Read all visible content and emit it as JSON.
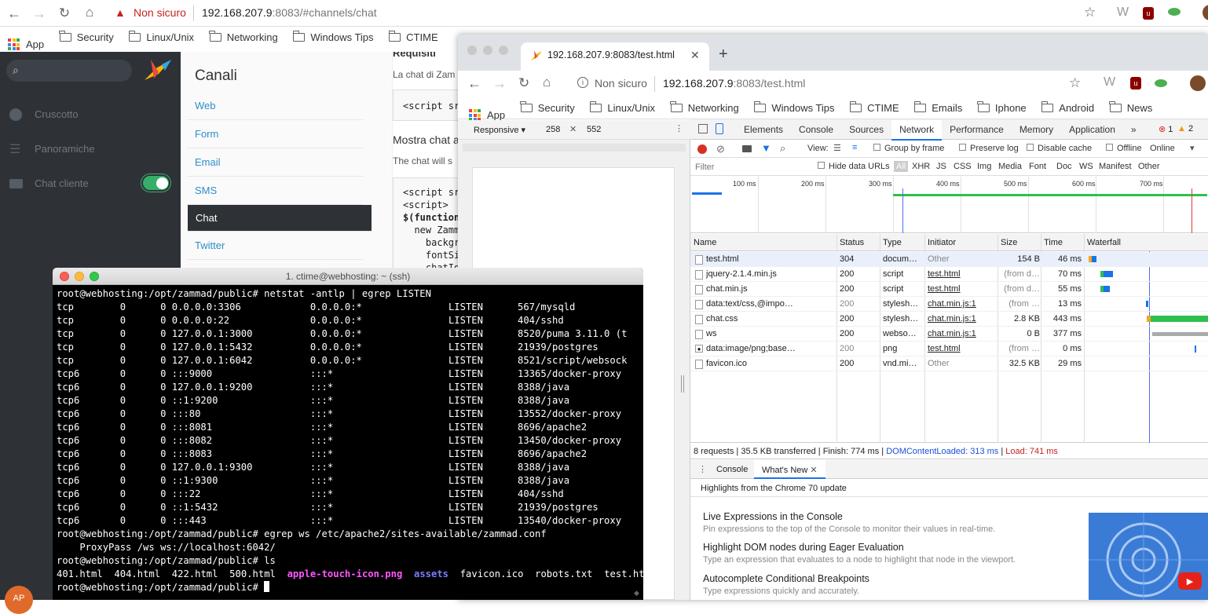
{
  "outer_browser": {
    "security_label": "Non sicuro",
    "url_host": "192.168.207.9",
    "url_rest": ":8083/#channels/chat",
    "bookmarks": [
      "App",
      "Security",
      "Linux/Unix",
      "Networking",
      "Windows Tips",
      "CTIME"
    ]
  },
  "zammad": {
    "sidebar": [
      {
        "label": "Cruscotto",
        "icon": "dashboard-icon"
      },
      {
        "label": "Panoramiche",
        "icon": "list-icon"
      },
      {
        "label": "Chat cliente",
        "icon": "chat-icon"
      }
    ],
    "avatar_initials": "AP",
    "page_title": "Canali",
    "channels": [
      "Web",
      "Form",
      "Email",
      "SMS",
      "Chat",
      "Twitter"
    ],
    "active_channel": "Chat",
    "content": {
      "section1": "Requisiti",
      "text1": "La chat di Zam",
      "code1": "<script sr",
      "section2": "Mostra chat a",
      "text2": "The chat will s",
      "code2": [
        "<script sr",
        "<script>",
        "$(function",
        "  new Zamm",
        "    backgr",
        "    fontSi",
        "    chatId"
      ]
    }
  },
  "inner_browser": {
    "tab_title": "192.168.207.9:8083/test.html",
    "security_label": "Non sicuro",
    "url_host": "192.168.207.9",
    "url_rest": ":8083/test.html",
    "bookmarks": [
      "App",
      "Security",
      "Linux/Unix",
      "Networking",
      "Windows Tips",
      "CTIME",
      "Emails",
      "Iphone",
      "Android",
      "News"
    ]
  },
  "device_toolbar": {
    "mode": "Responsive",
    "width": "258",
    "height": "552"
  },
  "devtools": {
    "tabs": [
      "Elements",
      "Console",
      "Sources",
      "Network",
      "Performance",
      "Memory",
      "Application"
    ],
    "active_tab": "Network",
    "errors": "1",
    "warnings": "2",
    "toolbar": {
      "view": "View:",
      "group_by_frame": "Group by frame",
      "preserve_log": "Preserve log",
      "disable_cache": "Disable cache",
      "offline": "Offline",
      "throttle": "Online"
    },
    "filter_placeholder": "Filter",
    "hide_data_urls": "Hide data URLs",
    "types": [
      "All",
      "XHR",
      "JS",
      "CSS",
      "Img",
      "Media",
      "Font",
      "Doc",
      "WS",
      "Manifest",
      "Other"
    ],
    "timeline_ticks": [
      "100 ms",
      "200 ms",
      "300 ms",
      "400 ms",
      "500 ms",
      "600 ms",
      "700 ms"
    ],
    "columns": [
      "Name",
      "Status",
      "Type",
      "Initiator",
      "Size",
      "Time",
      "Waterfall"
    ],
    "requests": [
      {
        "name": "test.html",
        "status": "304",
        "type": "docum…",
        "initiator": "Other",
        "size": "154 B",
        "time": "46 ms"
      },
      {
        "name": "jquery-2.1.4.min.js",
        "status": "200",
        "type": "script",
        "initiator": "test.html",
        "size": "(from d…",
        "time": "70 ms"
      },
      {
        "name": "chat.min.js",
        "status": "200",
        "type": "script",
        "initiator": "test.html",
        "size": "(from d…",
        "time": "55 ms"
      },
      {
        "name": "data:text/css,@impo…",
        "status": "200",
        "type": "stylesh…",
        "initiator": "chat.min.js:1",
        "size": "(from …",
        "time": "13 ms"
      },
      {
        "name": "chat.css",
        "status": "200",
        "type": "stylesh…",
        "initiator": "chat.min.js:1",
        "size": "2.8 KB",
        "time": "443 ms"
      },
      {
        "name": "ws",
        "status": "200",
        "type": "webso…",
        "initiator": "chat.min.js:1",
        "size": "0 B",
        "time": "377 ms"
      },
      {
        "name": "data:image/png;base…",
        "status": "200",
        "type": "png",
        "initiator": "test.html",
        "size": "(from …",
        "time": "0 ms"
      },
      {
        "name": "favicon.ico",
        "status": "200",
        "type": "vnd.mi…",
        "initiator": "Other",
        "size": "32.5 KB",
        "time": "29 ms"
      }
    ],
    "summary": "8 requests | 35.5 KB transferred | Finish: 774 ms |",
    "dom_loaded": "DOMContentLoaded: 313 ms",
    "load": "Load: 741 ms",
    "drawer_tabs": [
      "Console",
      "What's New"
    ],
    "drawer_header": "Highlights from the Chrome 70 update",
    "whats_new": [
      {
        "title": "Live Expressions in the Console",
        "desc": "Pin expressions to the top of the Console to monitor their values in real-time."
      },
      {
        "title": "Highlight DOM nodes during Eager Evaluation",
        "desc": "Type an expression that evaluates to a node to highlight that node in the viewport."
      },
      {
        "title": "Autocomplete Conditional Breakpoints",
        "desc": "Type expressions quickly and accurately."
      }
    ]
  },
  "terminal": {
    "title": "1. ctime@webhosting: ~ (ssh)",
    "lines": [
      "root@webhosting:/opt/zammad/public# netstat -antlp | egrep LISTEN",
      "tcp        0      0 0.0.0.0:3306            0.0.0.0:*               LISTEN      567/mysqld",
      "tcp        0      0 0.0.0.0:22              0.0.0.0:*               LISTEN      404/sshd",
      "tcp        0      0 127.0.0.1:3000          0.0.0.0:*               LISTEN      8520/puma 3.11.0 (t",
      "tcp        0      0 127.0.0.1:5432          0.0.0.0:*               LISTEN      21939/postgres",
      "tcp        0      0 127.0.0.1:6042          0.0.0.0:*               LISTEN      8521/script/websock",
      "tcp6       0      0 :::9000                 :::*                    LISTEN      13365/docker-proxy",
      "tcp6       0      0 127.0.0.1:9200          :::*                    LISTEN      8388/java",
      "tcp6       0      0 ::1:9200                :::*                    LISTEN      8388/java",
      "tcp6       0      0 :::80                   :::*                    LISTEN      13552/docker-proxy",
      "tcp6       0      0 :::8081                 :::*                    LISTEN      8696/apache2",
      "tcp6       0      0 :::8082                 :::*                    LISTEN      13450/docker-proxy",
      "tcp6       0      0 :::8083                 :::*                    LISTEN      8696/apache2",
      "tcp6       0      0 127.0.0.1:9300          :::*                    LISTEN      8388/java",
      "tcp6       0      0 ::1:9300                :::*                    LISTEN      8388/java",
      "tcp6       0      0 :::22                   :::*                    LISTEN      404/sshd",
      "tcp6       0      0 ::1:5432                :::*                    LISTEN      21939/postgres",
      "tcp6       0      0 :::443                  :::*                    LISTEN      13540/docker-proxy",
      "root@webhosting:/opt/zammad/public# egrep ws /etc/apache2/sites-available/zammad.conf",
      "    ProxyPass /ws ws://localhost:6042/",
      "root@webhosting:/opt/zammad/public# ls"
    ],
    "ls_output": [
      {
        "name": "401.html",
        "kind": "file"
      },
      {
        "name": "404.html",
        "kind": "file"
      },
      {
        "name": "422.html",
        "kind": "file"
      },
      {
        "name": "500.html",
        "kind": "file"
      },
      {
        "name": "apple-touch-icon.png",
        "kind": "image"
      },
      {
        "name": "assets",
        "kind": "dir"
      },
      {
        "name": "favicon.ico",
        "kind": "file"
      },
      {
        "name": "robots.txt",
        "kind": "file"
      },
      {
        "name": "test.html",
        "kind": "file"
      }
    ],
    "prompt": "root@webhosting:/opt/zammad/public# "
  },
  "colors": {
    "zammad_sidebar": "#2e3237",
    "zammad_link": "#2e8ec9",
    "warning": "#c5221f",
    "toggle": "#38ad69",
    "image_file": "#ff55ff",
    "dir": "#7b7bff"
  }
}
